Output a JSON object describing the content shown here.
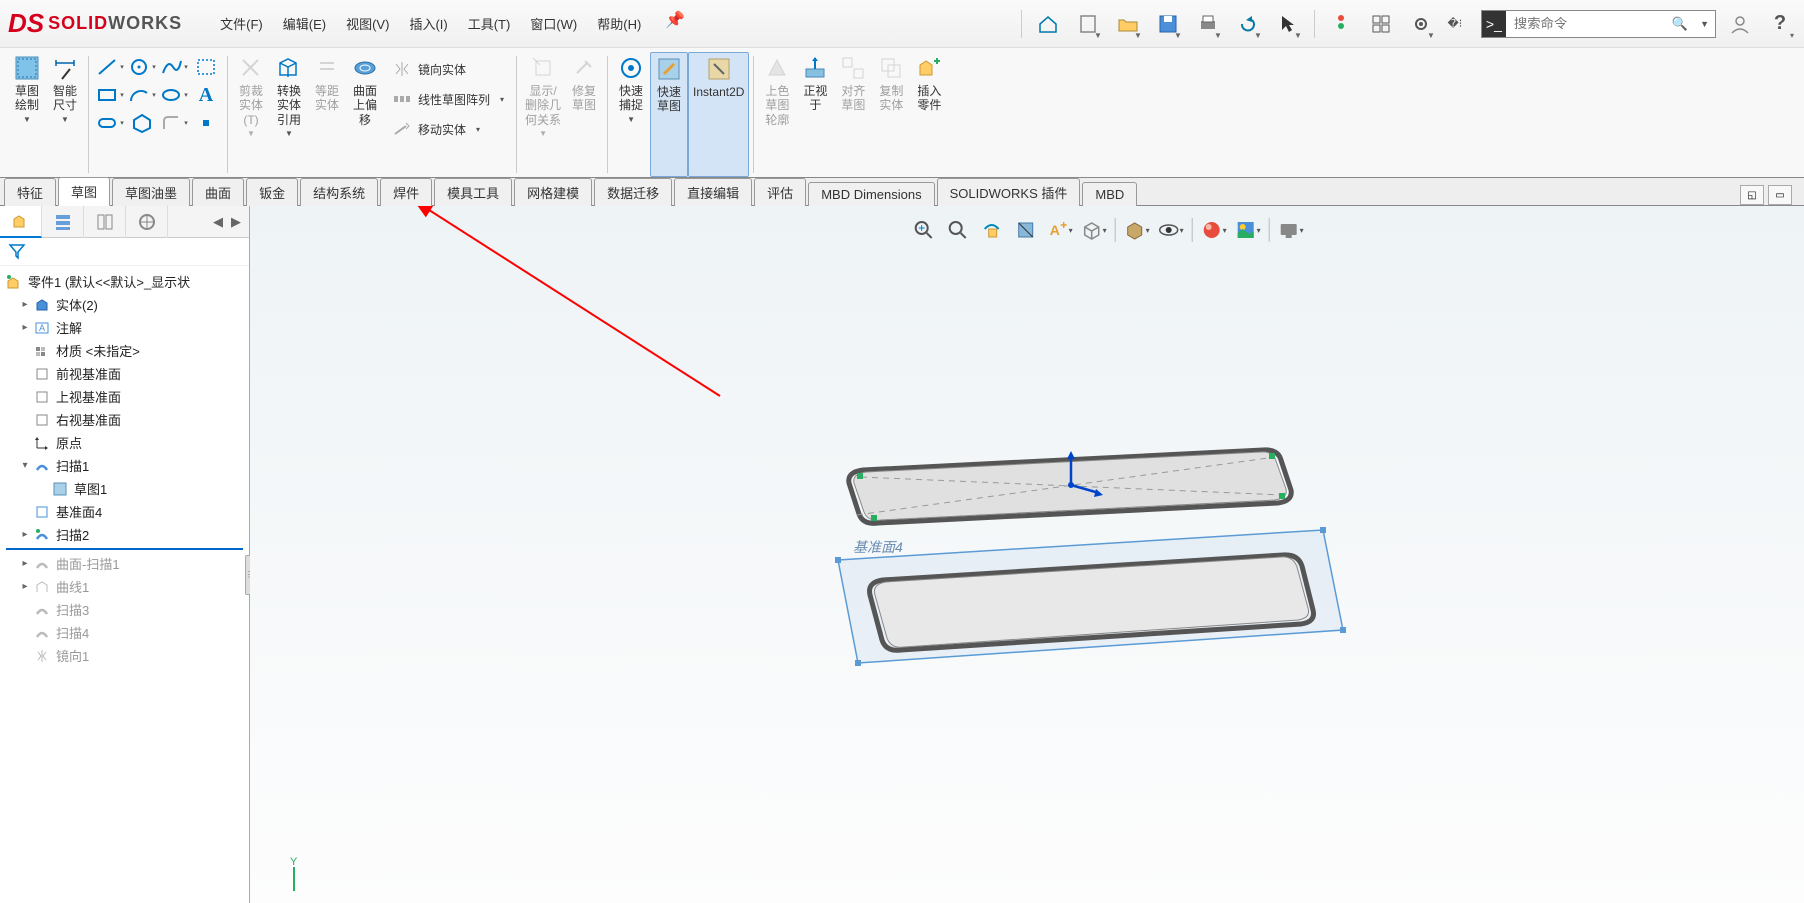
{
  "app": {
    "logo_solid": "SOLID",
    "logo_works": "WORKS"
  },
  "menu": {
    "file": "文件(F)",
    "edit": "编辑(E)",
    "view": "视图(V)",
    "insert": "插入(I)",
    "tools": "工具(T)",
    "window": "窗口(W)",
    "help": "帮助(H)"
  },
  "search": {
    "placeholder": "搜索命令"
  },
  "ribbon": {
    "sketch": "草图\n绘制",
    "smart_dim": "智能\n尺寸",
    "trim": "剪裁\n实体\n(T)",
    "convert": "转换\n实体\n引用",
    "offset": "等距\n实体",
    "surface_offset": "曲面\n上偏\n移",
    "mirror": "镜向实体",
    "linear_pattern": "线性草图阵列",
    "move": "移动实体",
    "show_delete": "显示/\n删除几\n何关系",
    "repair": "修复\n草图",
    "quick_snap": "快速\n捕捉",
    "rapid_sketch": "快速\n草图",
    "instant2d": "Instant2D",
    "color_outline": "上色\n草图\n轮廓",
    "normal_to": "正视\n于",
    "align_sketch": "对齐\n草图",
    "copy_entity": "复制\n实体",
    "insert_part": "插入\n零件"
  },
  "tabs": {
    "features": "特征",
    "sketch": "草图",
    "sketch_ink": "草图油墨",
    "surfaces": "曲面",
    "sheet_metal": "钣金",
    "structural": "结构系统",
    "weldments": "焊件",
    "mold_tools": "模具工具",
    "mesh": "网格建模",
    "data_migration": "数据迁移",
    "direct_edit": "直接编辑",
    "evaluate": "评估",
    "mbd_dim": "MBD Dimensions",
    "sw_addins": "SOLIDWORKS 插件",
    "mbd": "MBD"
  },
  "tree": {
    "root": "零件1  (默认<<默认>_显示状",
    "solid_bodies": "实体(2)",
    "annotations": "注解",
    "material": "材质 <未指定>",
    "front_plane": "前视基准面",
    "top_plane": "上视基准面",
    "right_plane": "右视基准面",
    "origin": "原点",
    "sweep1": "扫描1",
    "sketch1": "草图1",
    "plane4": "基准面4",
    "sweep2": "扫描2",
    "surf_sweep1": "曲面-扫描1",
    "curve1": "曲线1",
    "sweep3": "扫描3",
    "sweep4": "扫描4",
    "mirror1": "镜向1"
  },
  "canvas": {
    "plane_label": "基准面4"
  }
}
